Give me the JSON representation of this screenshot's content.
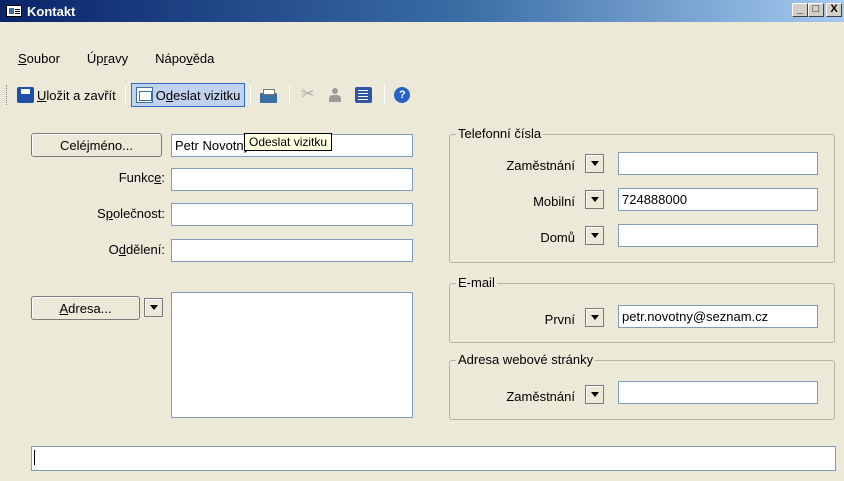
{
  "window": {
    "title": "Kontakt",
    "controls": [
      "_",
      "□",
      "X"
    ]
  },
  "menu": {
    "items": [
      "Soubor",
      "Úpravy",
      "Nápověda"
    ]
  },
  "toolbar": {
    "save_close_label": "Uložit a zavřít",
    "send_card_label": "Odeslat vizitku",
    "tooltip": "Odeslat vizitku",
    "icons": [
      "save-icon",
      "vcard-icon",
      "print-icon",
      "cut-icon",
      "contact-icon",
      "address-book-icon",
      "help-icon"
    ]
  },
  "name_section": {
    "full_name_button": "Celé jméno...",
    "full_name_value": "Petr Novotný",
    "function_label": "Funkce:",
    "function_value": "",
    "company_label": "Společnost:",
    "company_value": "",
    "department_label": "Oddělení:",
    "department_value": ""
  },
  "address_section": {
    "address_button": "Adresa...",
    "address_value": ""
  },
  "phone_group": {
    "title": "Telefonní čísla",
    "rows": [
      {
        "label": "Zaměstnání",
        "value": ""
      },
      {
        "label": "Mobilní",
        "value": "724888000"
      },
      {
        "label": "Domů",
        "value": ""
      }
    ]
  },
  "email_group": {
    "title": "E-mail",
    "label": "První",
    "value": "petr.novotny@seznam.cz"
  },
  "web_group": {
    "title": "Adresa webové stránky",
    "label": "Zaměstnání",
    "value": ""
  },
  "notes": {
    "value": ""
  }
}
